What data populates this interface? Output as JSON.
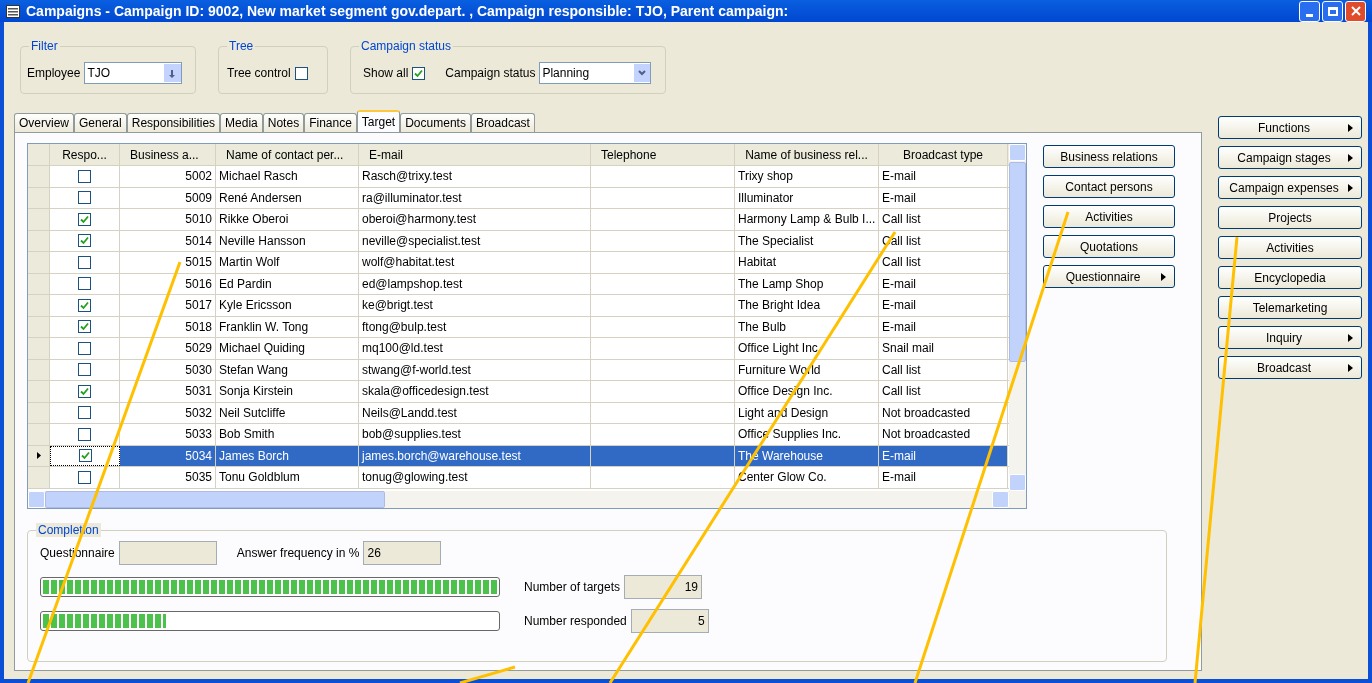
{
  "window": {
    "title": "Campaigns - Campaign ID: 9002, New market segment gov.depart. , Campaign responsible: TJO, Parent campaign:"
  },
  "filter": {
    "legend": "Filter",
    "label": "Employee",
    "value": "TJO"
  },
  "tree": {
    "legend": "Tree",
    "label": "Tree control",
    "checked": false
  },
  "campaign_status": {
    "legend": "Campaign status",
    "show_all_label": "Show all",
    "show_all_checked": true,
    "status_label": "Campaign status",
    "status_value": "Planning"
  },
  "tabs": [
    {
      "label": "Overview",
      "selected": false
    },
    {
      "label": "General",
      "selected": false
    },
    {
      "label": "Responsibilities",
      "selected": false
    },
    {
      "label": "Media",
      "selected": false
    },
    {
      "label": "Notes",
      "selected": false
    },
    {
      "label": "Finance",
      "selected": false
    },
    {
      "label": "Target",
      "selected": true
    },
    {
      "label": "Documents",
      "selected": false
    },
    {
      "label": "Broadcast",
      "selected": false
    }
  ],
  "grid": {
    "columns": [
      "Respo...",
      "Business a...",
      "Name of contact per...",
      "E-mail",
      "Telephone",
      "Name of business rel...",
      "Broadcast type"
    ],
    "rows": [
      {
        "responded": false,
        "business": "5002",
        "contact": "Michael Rasch",
        "email": "Rasch@trixy.test",
        "business_name": "Trixy shop",
        "broadcast_type": "E-mail",
        "selected": false
      },
      {
        "responded": false,
        "business": "5009",
        "contact": "René Andersen",
        "email": "ra@illuminator.test",
        "business_name": "Illuminator",
        "broadcast_type": "E-mail",
        "selected": false
      },
      {
        "responded": true,
        "business": "5010",
        "contact": "Rikke Oberoi",
        "email": "oberoi@harmony.test",
        "business_name": "Harmony Lamp & Bulb I...",
        "broadcast_type": "Call list",
        "selected": false
      },
      {
        "responded": true,
        "business": "5014",
        "contact": "Neville Hansson",
        "email": "neville@specialist.test",
        "business_name": "The Specialist",
        "broadcast_type": "Call list",
        "selected": false
      },
      {
        "responded": false,
        "business": "5015",
        "contact": "Martin Wolf",
        "email": "wolf@habitat.test",
        "business_name": "Habitat",
        "broadcast_type": "Call list",
        "selected": false
      },
      {
        "responded": false,
        "business": "5016",
        "contact": "Ed Pardin",
        "email": "ed@lampshop.test",
        "business_name": "The Lamp Shop",
        "broadcast_type": "E-mail",
        "selected": false
      },
      {
        "responded": true,
        "business": "5017",
        "contact": "Kyle Ericsson",
        "email": "ke@brigt.test",
        "business_name": "The Bright Idea",
        "broadcast_type": "E-mail",
        "selected": false
      },
      {
        "responded": true,
        "business": "5018",
        "contact": "Franklin W. Tong",
        "email": "ftong@bulp.test",
        "business_name": "The Bulb",
        "broadcast_type": "E-mail",
        "selected": false
      },
      {
        "responded": false,
        "business": "5029",
        "contact": "Michael Quiding",
        "email": "mq100@ld.test",
        "business_name": "Office Light Inc.",
        "broadcast_type": "Snail mail",
        "selected": false
      },
      {
        "responded": false,
        "business": "5030",
        "contact": "Stefan Wang",
        "email": "stwang@f-world.test",
        "business_name": "Furniture World",
        "broadcast_type": "Call list",
        "selected": false
      },
      {
        "responded": true,
        "business": "5031",
        "contact": "Sonja Kirstein",
        "email": "skala@officedesign.test",
        "business_name": "Office Design Inc.",
        "broadcast_type": "Call list",
        "selected": false
      },
      {
        "responded": false,
        "business": "5032",
        "contact": "Neil Sutcliffe",
        "email": "Neils@Landd.test",
        "business_name": "Light and Design",
        "broadcast_type": "Not broadcasted",
        "selected": false
      },
      {
        "responded": false,
        "business": "5033",
        "contact": "Bob Smith",
        "email": "bob@supplies.test",
        "business_name": "Office Supplies Inc.",
        "broadcast_type": "Not broadcasted",
        "selected": false
      },
      {
        "responded": true,
        "business": "5034",
        "contact": "James Borch",
        "email": "james.borch@warehouse.test",
        "business_name": "The Warehouse",
        "broadcast_type": "E-mail",
        "selected": true
      },
      {
        "responded": false,
        "business": "5035",
        "contact": "Tonu Goldblum",
        "email": "tonug@glowing.test",
        "business_name": "Center Glow Co.",
        "broadcast_type": "E-mail",
        "selected": false
      }
    ]
  },
  "grid_buttons": [
    {
      "label": "Business relations",
      "submenu": false
    },
    {
      "label": "Contact persons",
      "submenu": false
    },
    {
      "label": "Activities",
      "submenu": false
    },
    {
      "label": "Quotations",
      "submenu": false
    },
    {
      "label": "Questionnaire",
      "submenu": true
    }
  ],
  "side_buttons": [
    {
      "label": "Functions",
      "submenu": true
    },
    {
      "label": "Campaign stages",
      "submenu": true
    },
    {
      "label": "Campaign expenses",
      "submenu": true
    },
    {
      "label": "Projects",
      "submenu": false
    },
    {
      "label": "Activities",
      "submenu": false
    },
    {
      "label": "Encyclopedia",
      "submenu": false
    },
    {
      "label": "Telemarketing",
      "submenu": false
    },
    {
      "label": "Inquiry",
      "submenu": true
    },
    {
      "label": "Broadcast",
      "submenu": true
    }
  ],
  "completion": {
    "legend": "Completion",
    "questionnaire_label": "Questionnaire",
    "answer_label": "Answer frequency in %",
    "answer_value": "26",
    "targets_bar": {
      "level": 1
    },
    "responded_bar": {
      "level": 0.27
    },
    "targets_label": "Number of targets",
    "targets_value": "19",
    "responded_label": "Number responded",
    "responded_value": "5"
  }
}
